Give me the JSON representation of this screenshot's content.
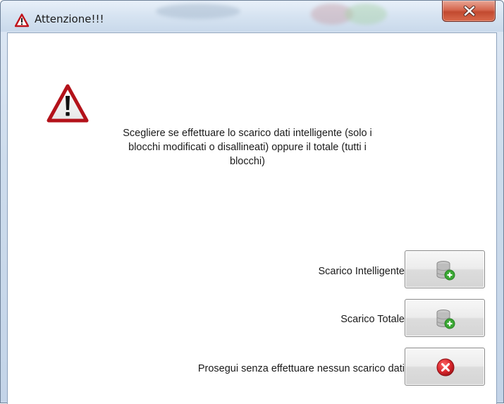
{
  "window": {
    "title": "Attenzione!!!",
    "title_icon": "warning-triangle-icon",
    "close_icon": "close-x-icon"
  },
  "dialog": {
    "icon": "warning-exclamation-icon",
    "message_lines": [
      "Scegliere se effettuare lo scarico dati intelligente (solo i",
      "blocchi modificati o disallineati) oppure il totale (tutti i",
      "blocchi)"
    ]
  },
  "options": [
    {
      "label": "Scarico Intelligente",
      "icon": "database-add-icon"
    },
    {
      "label": "Scarico Totale",
      "icon": "database-add-icon"
    },
    {
      "label": "Prosegui senza effettuare nessun scarico dati",
      "icon": "red-cancel-icon"
    }
  ],
  "colors": {
    "warning_red": "#c0141c",
    "cancel_red": "#d8262c",
    "add_green": "#3aa833",
    "close_button": "#c9563c"
  }
}
